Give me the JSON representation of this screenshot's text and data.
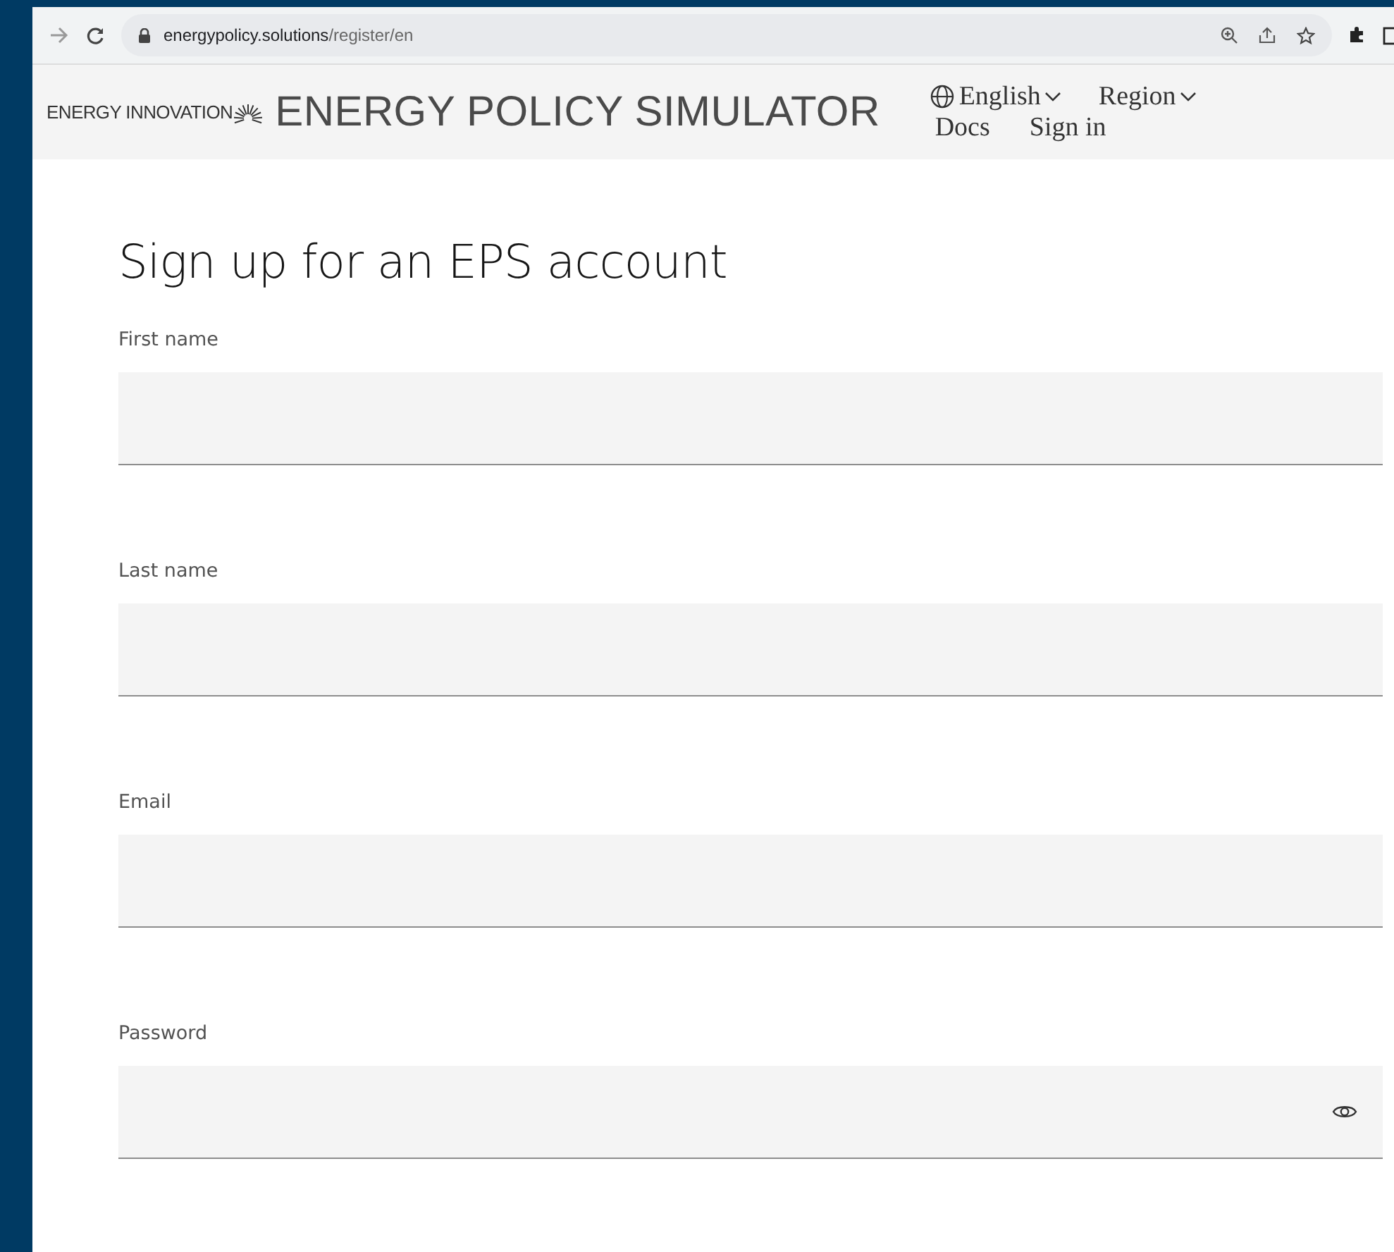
{
  "browser": {
    "url_host": "energypolicy.solutions",
    "url_path": "/register/en"
  },
  "header": {
    "brand": "ENERGY INNOVATION",
    "title": "ENERGY POLICY SIMULATOR",
    "language": "English",
    "region": "Region",
    "docs": "Docs",
    "sign_in": "Sign in"
  },
  "heading": "Sign up for an EPS account",
  "fields": [
    {
      "label": "First name",
      "kind": "text"
    },
    {
      "label": "Last name",
      "kind": "text"
    },
    {
      "label": "Email",
      "kind": "text"
    },
    {
      "label": "Password",
      "kind": "password"
    }
  ]
}
